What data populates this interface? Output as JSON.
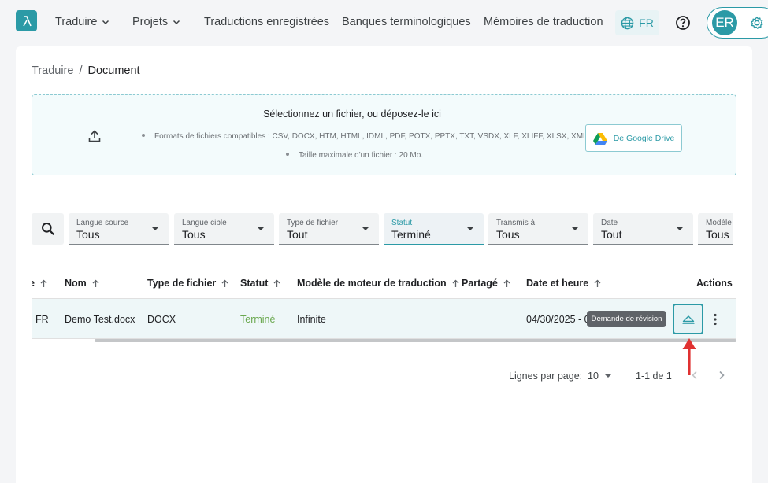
{
  "nav": {
    "items": [
      {
        "label": "Traduire",
        "dropdown": true
      },
      {
        "label": "Projets",
        "dropdown": true
      },
      {
        "label": "Traductions enregistrées",
        "dropdown": false
      },
      {
        "label": "Banques terminologiques",
        "dropdown": false
      },
      {
        "label": "Mémoires de traduction",
        "dropdown": false
      }
    ],
    "language": "FR",
    "avatar_initials": "ER"
  },
  "breadcrumb": {
    "parent": "Traduire",
    "separator": "/",
    "current": "Document"
  },
  "upload": {
    "title": "Sélectionnez un fichier, ou déposez-le ici",
    "formats": "Formats de fichiers compatibles : CSV, DOCX, HTM, HTML, IDML, PDF, POTX, PPTX, TXT, VSDX, XLF, XLIFF, XLSX, XML",
    "max_size": "Taille maximale d'un fichier : 20 Mo.",
    "gdrive_label": "De Google Drive"
  },
  "filters": [
    {
      "label": "Langue source",
      "value": "Tous",
      "active": false
    },
    {
      "label": "Langue cible",
      "value": "Tous",
      "active": false
    },
    {
      "label": "Type de fichier",
      "value": "Tout",
      "active": false
    },
    {
      "label": "Statut",
      "value": "Terminé",
      "active": true
    },
    {
      "label": "Transmis à",
      "value": "Tous",
      "active": false
    },
    {
      "label": "Date",
      "value": "Tout",
      "active": false
    },
    {
      "label": "Modèle",
      "value": "Tous",
      "active": false
    }
  ],
  "table": {
    "columns": {
      "lang": "e",
      "name": "Nom",
      "type": "Type de fichier",
      "status": "Statut",
      "engine": "Modèle de moteur de traduction",
      "shared": "Partagé",
      "date": "Date et heure",
      "actions": "Actions"
    },
    "rows": [
      {
        "lang": "FR",
        "name": "Demo Test.docx",
        "type": "DOCX",
        "status": "Terminé",
        "engine": "Infinite",
        "shared": "",
        "date": "04/30/2025 - 0"
      }
    ]
  },
  "tooltip": "Demande de révision",
  "pagination": {
    "label": "Lignes par page:",
    "per_page": "10",
    "range": "1-1 de 1"
  },
  "colors": {
    "accent": "#2b9aa6",
    "status_done": "#6aa84f",
    "annotation": "#e03131"
  }
}
